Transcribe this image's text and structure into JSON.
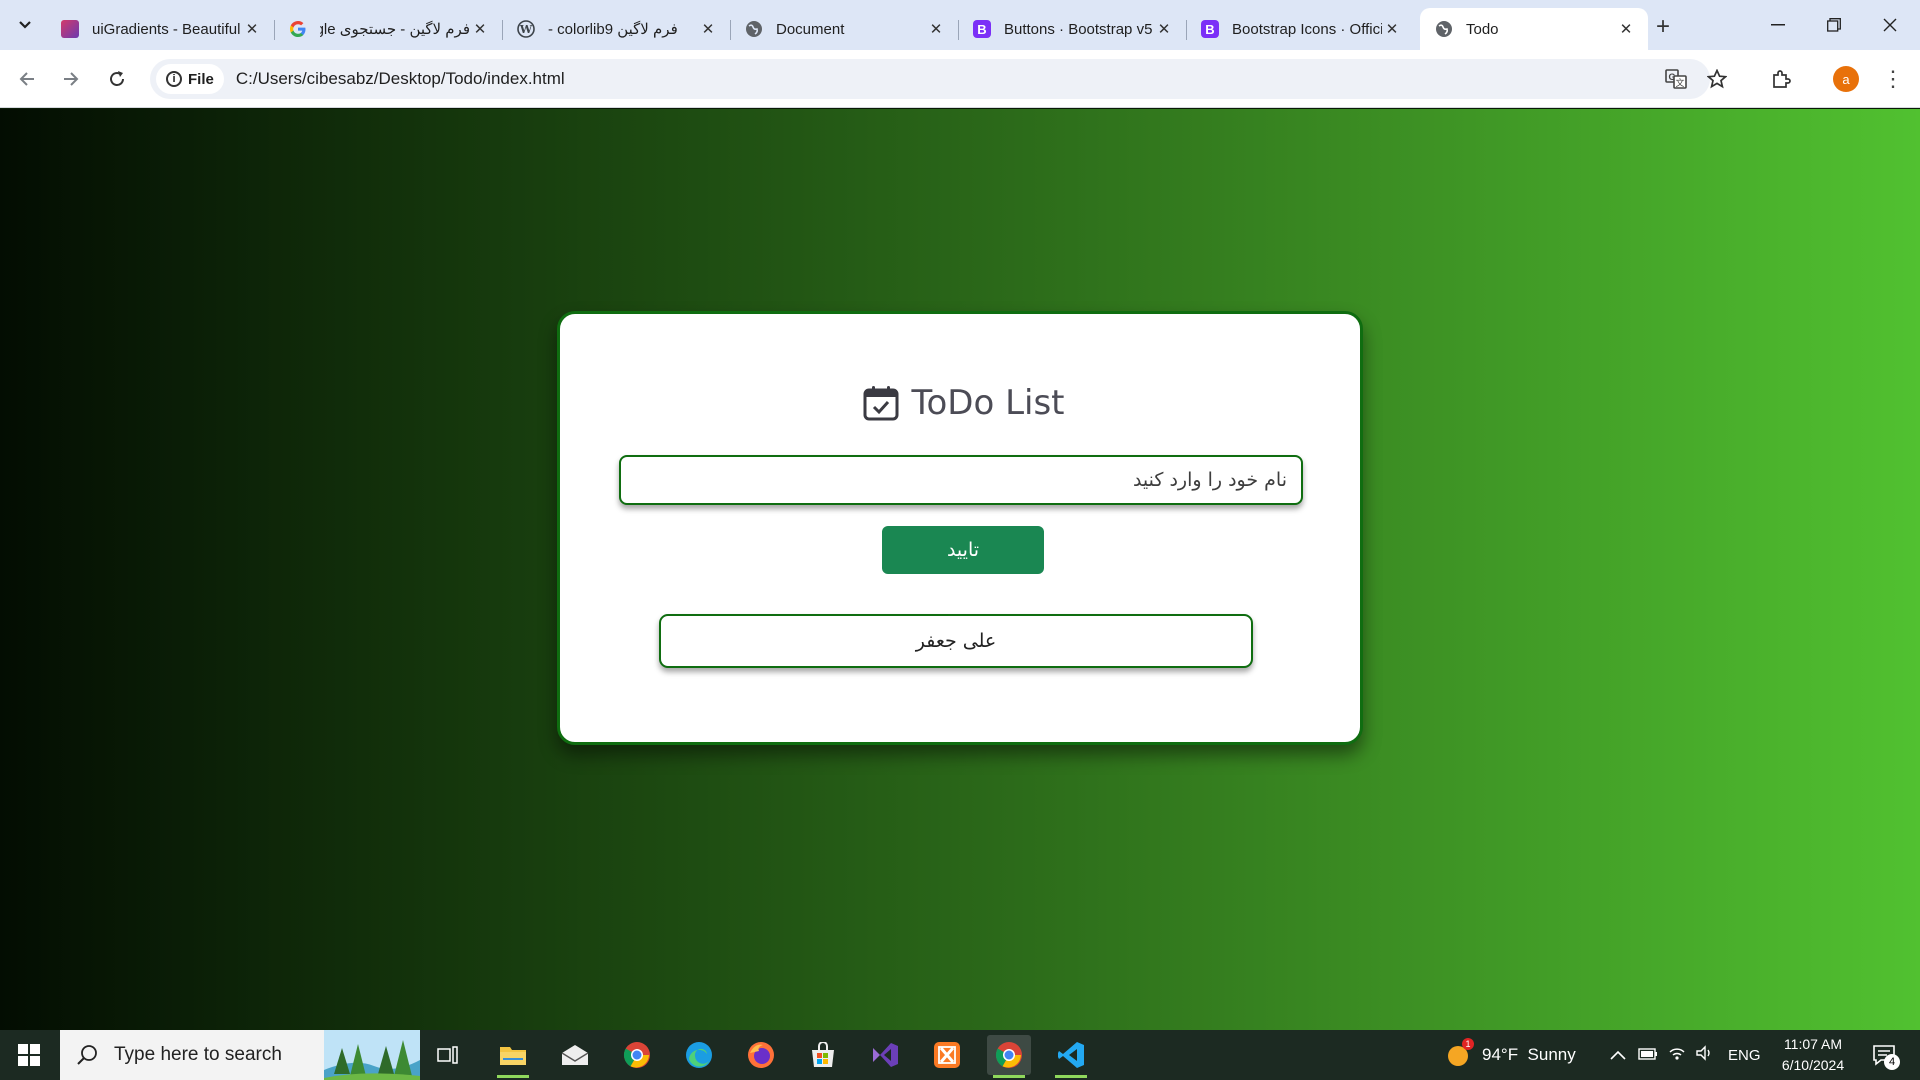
{
  "browser": {
    "tabs": [
      {
        "title": "uiGradients - Beautiful",
        "icon": "uigradients-favicon"
      },
      {
        "title": "فرم لاگین - جستجوی Google",
        "icon": "google-favicon"
      },
      {
        "title": "فرم لاگین colorlib9 -",
        "icon": "wordpress-favicon"
      },
      {
        "title": "Document",
        "icon": "globe-favicon"
      },
      {
        "title": "Buttons · Bootstrap v5",
        "icon": "bootstrap-favicon"
      },
      {
        "title": "Bootstrap Icons · Official",
        "icon": "bootstrap-favicon"
      },
      {
        "title": "Todo",
        "icon": "globe-favicon"
      }
    ],
    "address": {
      "scheme_chip": "File",
      "url": "C:/Users/cibesabz/Desktop/Todo/index.html"
    },
    "profile_initial": "a"
  },
  "page": {
    "title": "ToDo List",
    "input_placeholder": "نام خود را وارد کنید",
    "submit_label": "تایید",
    "todos": [
      "علی جعفر"
    ],
    "colors": {
      "gradient_start": "#030d02",
      "gradient_end": "#51c130",
      "accent_border": "#0f6d10",
      "button": "#1a8752"
    }
  },
  "taskbar": {
    "search_placeholder": "Type here to search",
    "weather": "94°F  Sunny",
    "language": "ENG",
    "time": "11:07 AM",
    "date": "6/10/2024",
    "notifications": "4",
    "weather_badge": "1"
  }
}
